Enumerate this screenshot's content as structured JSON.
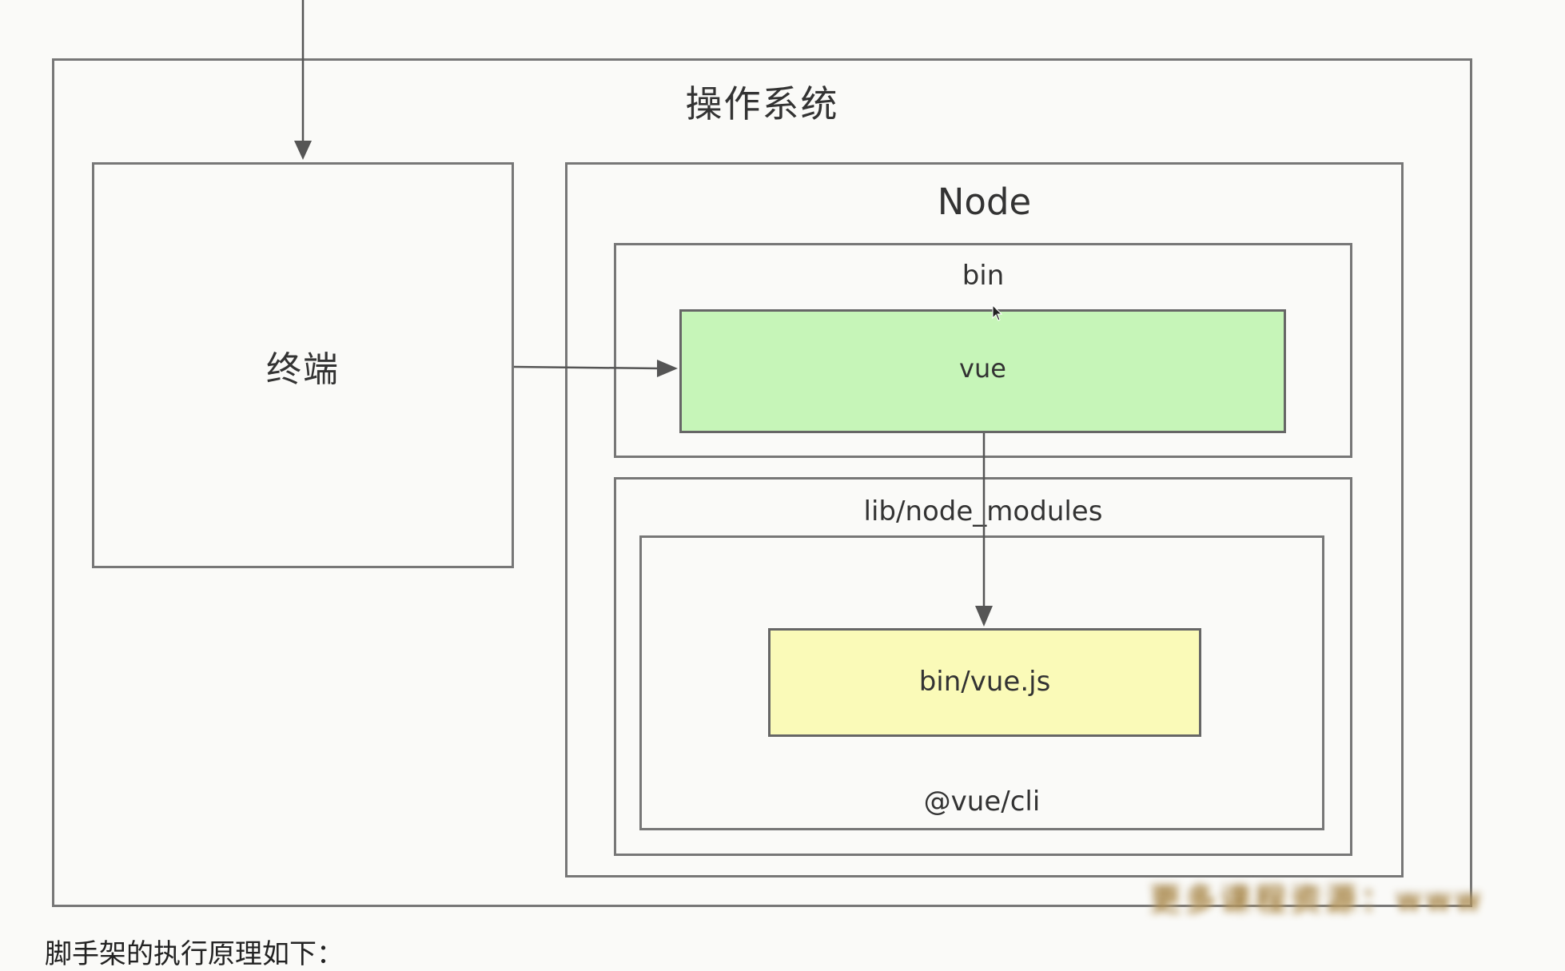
{
  "diagram": {
    "os": {
      "title": "操作系统"
    },
    "terminal": {
      "label": "终端"
    },
    "node": {
      "title": "Node",
      "bin": {
        "label": "bin",
        "vue": {
          "label": "vue",
          "color": "#c6f5b8"
        }
      },
      "lib": {
        "label": "lib/node_modules",
        "package": {
          "label": "@vue/cli",
          "entry": {
            "label": "bin/vue.js",
            "color": "#fafab8"
          }
        }
      }
    },
    "arrows": [
      {
        "from": "above",
        "to": "terminal"
      },
      {
        "from": "terminal",
        "to": "vue"
      },
      {
        "from": "vue",
        "to": "bin/vue.js"
      }
    ]
  },
  "caption": "脚手架的执行原理如下：",
  "watermark": "更多课程资源：www"
}
